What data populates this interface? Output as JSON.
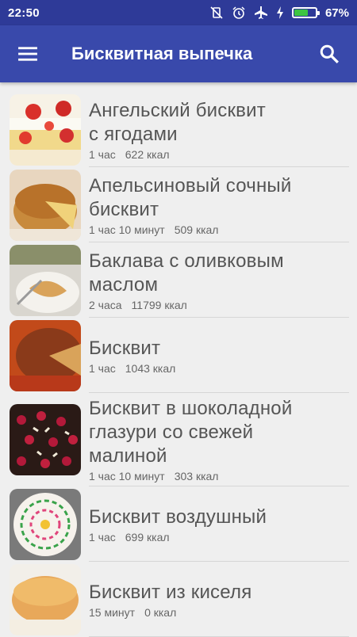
{
  "status": {
    "time": "22:50",
    "battery_pct": "67%",
    "battery_level": 0.67
  },
  "appbar": {
    "title": "Бисквитная выпечка"
  },
  "recipes": [
    {
      "name_lines": [
        "Ангельский бисквит",
        "с ягодами"
      ],
      "time": "1 час",
      "kcal": "622 ккал"
    },
    {
      "name_lines": [
        "Апельсиновый сочный",
        "бисквит"
      ],
      "time": "1 час 10 минут",
      "kcal": "509 ккал"
    },
    {
      "name_lines": [
        "Баклава с оливковым",
        "маслом"
      ],
      "time": "2 часа",
      "kcal": "11799 ккал"
    },
    {
      "name_lines": [
        "Бисквит"
      ],
      "time": "1 час",
      "kcal": "1043 ккал"
    },
    {
      "name_lines": [
        "Бисквит в шоколадной",
        "глазури со свежей",
        "малиной"
      ],
      "time": "1 час 10 минут",
      "kcal": "303 ккал"
    },
    {
      "name_lines": [
        "Бисквит воздушный"
      ],
      "time": "1 час",
      "kcal": "699 ккал"
    },
    {
      "name_lines": [
        "Бисквит из киселя"
      ],
      "time": "15 минут",
      "kcal": "0 ккал"
    }
  ]
}
